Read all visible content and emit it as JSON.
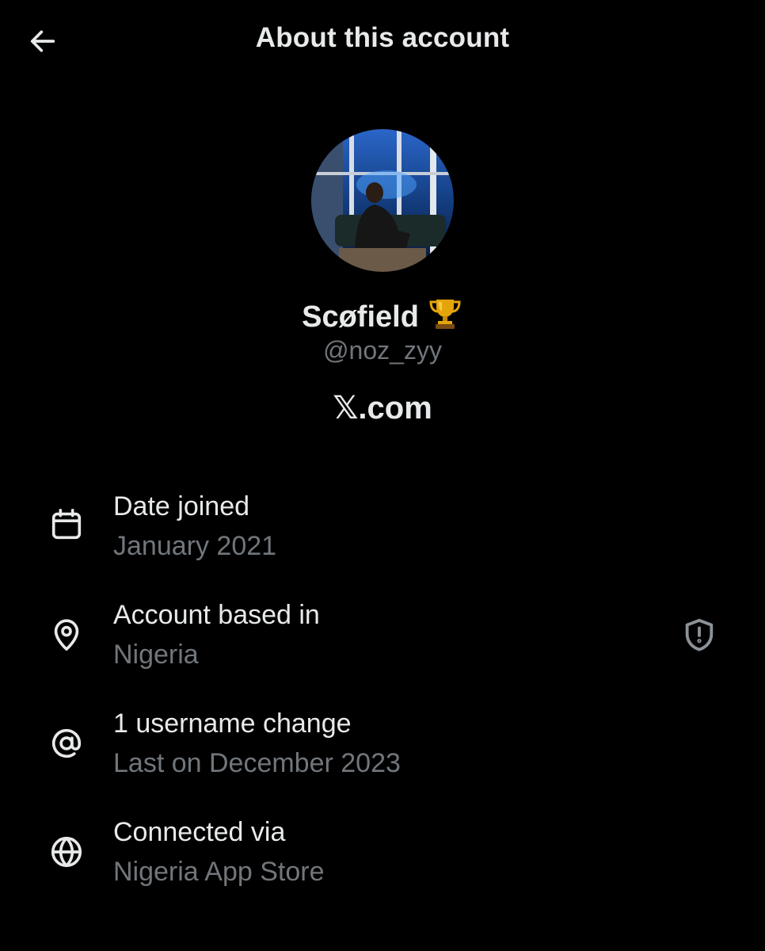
{
  "header": {
    "title": "About this account",
    "back_icon": "arrow-left-icon"
  },
  "profile": {
    "display_name": "Scøfield",
    "name_emoji": "trophy",
    "handle": "@noz_zyy",
    "platform": "𝕏.com"
  },
  "details": [
    {
      "icon": "calendar-icon",
      "label": "Date joined",
      "value": "January 2021"
    },
    {
      "icon": "location-pin-icon",
      "label": "Account based in",
      "value": "Nigeria",
      "action_icon": "shield-alert-icon"
    },
    {
      "icon": "at-sign-icon",
      "label": "1 username change",
      "value": "Last on December 2023"
    },
    {
      "icon": "globe-icon",
      "label": "Connected via",
      "value": "Nigeria App Store"
    }
  ],
  "colors": {
    "background": "#000000",
    "primary_text": "#e7e9ea",
    "secondary_text": "#71767b"
  }
}
